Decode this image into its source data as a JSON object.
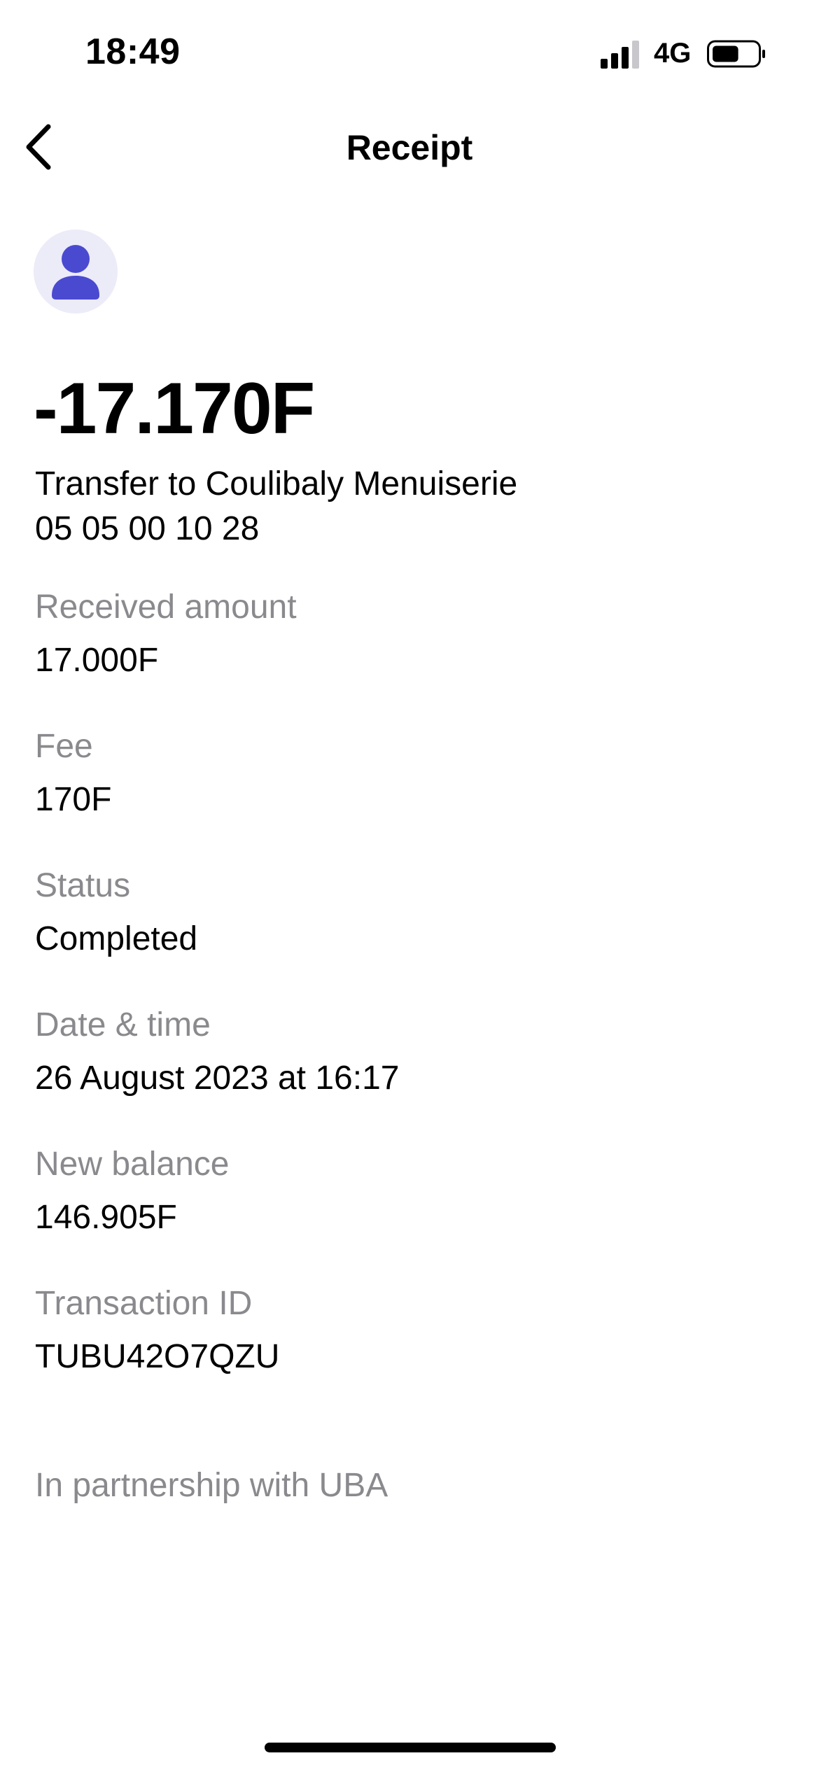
{
  "status_bar": {
    "time": "18:49",
    "network": "4G",
    "signal_icon": "cellular-signal-icon",
    "battery_icon": "battery-icon",
    "battery_level": 0.6
  },
  "nav": {
    "title": "Receipt",
    "back_icon": "chevron-left-icon"
  },
  "receipt": {
    "avatar_icon": "person-icon",
    "amount": "-17.170F",
    "description": "Transfer to Coulibaly Menuiserie",
    "phone": "05 05 00 10 28",
    "details": [
      {
        "label": "Received amount",
        "value": "17.000F"
      },
      {
        "label": "Fee",
        "value": "170F"
      },
      {
        "label": "Status",
        "value": "Completed"
      },
      {
        "label": "Date & time",
        "value": "26 August 2023 at 16:17"
      },
      {
        "label": "New balance",
        "value": "146.905F"
      },
      {
        "label": "Transaction ID",
        "value": "TUBU42O7QZU"
      }
    ],
    "partnership": "In partnership with UBA"
  },
  "colors": {
    "accent": "#4a4ad0",
    "avatar_bg": "#ecebf8",
    "label_gray": "#8a8a8e"
  }
}
